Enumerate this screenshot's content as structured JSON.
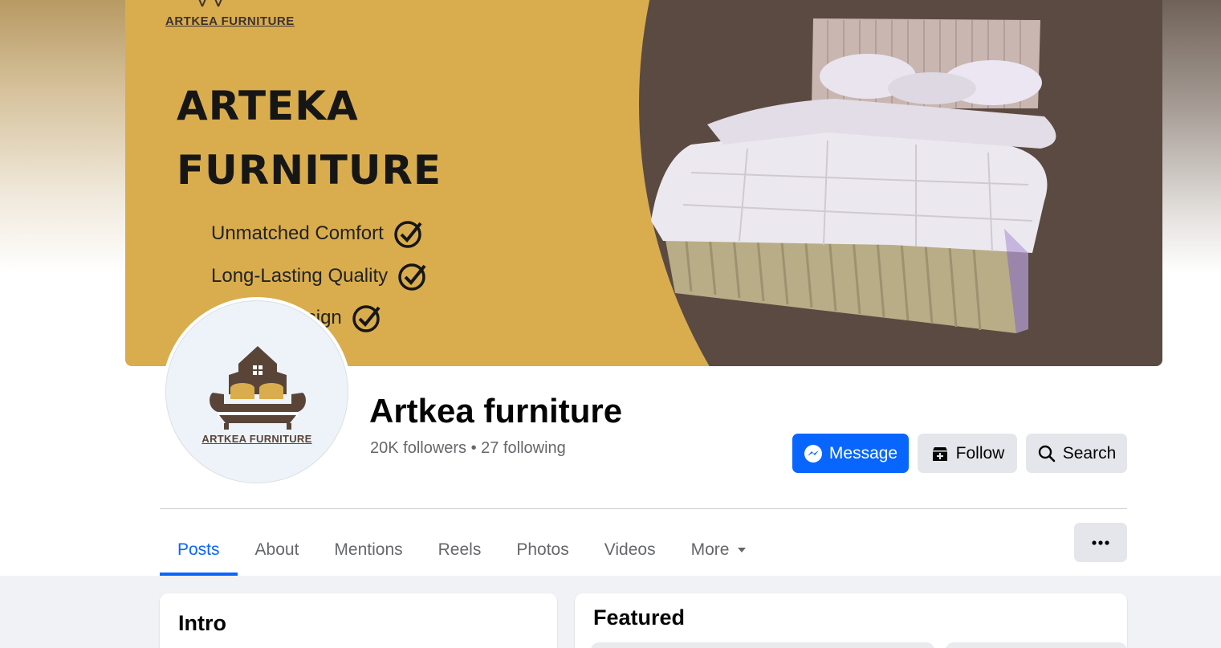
{
  "cover": {
    "brand_small": "ARTKEA FURNITURE",
    "title_line1": "ARTEKA",
    "title_line2": "FURNITURE",
    "features": [
      "Unmatched Comfort",
      "Long-Lasting Quality",
      "Elegant Design"
    ],
    "colors": {
      "mustard": "#d9ad4e",
      "brown": "#5b4a42"
    }
  },
  "avatar": {
    "logo_text": "ARTKEA FURNITURE"
  },
  "page": {
    "name": "Artkea furniture",
    "stats": "20K followers • 27 following"
  },
  "actions": {
    "message_label": "Message",
    "follow_label": "Follow",
    "search_label": "Search"
  },
  "tabs": [
    {
      "label": "Posts",
      "active": true
    },
    {
      "label": "About"
    },
    {
      "label": "Mentions"
    },
    {
      "label": "Reels"
    },
    {
      "label": "Photos"
    },
    {
      "label": "Videos"
    },
    {
      "label": "More"
    }
  ],
  "cards": {
    "intro_title": "Intro",
    "featured_title": "Featured"
  },
  "colors": {
    "accent": "#0866ff",
    "secondary_bg": "#e4e6eb",
    "muted_text": "#65676b"
  }
}
